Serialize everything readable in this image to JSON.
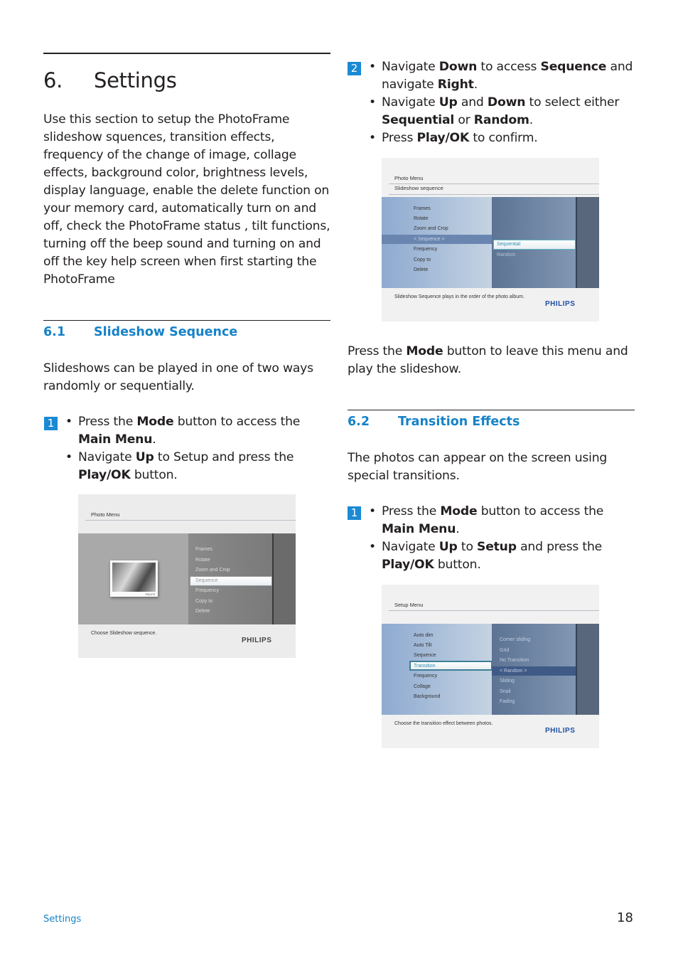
{
  "chapter": {
    "number": "6.",
    "title": "Settings"
  },
  "intro": "Use this section to setup the PhotoFrame slideshow squences, transition effects, frequency of the change of image, collage effects, background color, brightness levels, display language, enable the delete function on your memory card, automatically turn on and off, check the PhotoFrame status , tilt functions, turning off the beep sound and turning on and off the key help screen when first starting the PhotoFrame",
  "section_6_1": {
    "number": "6.1",
    "title": "Slideshow Sequence",
    "description_line1": "Slideshows can be played in one of two ways",
    "description_line2": "randomly or sequentially.",
    "step1": {
      "badge": "1",
      "bullets": [
        {
          "pre": "Press the ",
          "b1": "Mode",
          "mid": " button to access the ",
          "b2": "Main Menu",
          "post": "."
        },
        {
          "pre": "Navigate ",
          "b1": "Up",
          "mid": " to Setup and press the ",
          "b2": "Play/OK",
          "post": " button."
        }
      ]
    },
    "screenshot1": {
      "title": "Photo Menu",
      "menu_items": [
        "Frames",
        "Rotate",
        "Zoom and Crop",
        "Sequence",
        "Frequency",
        "Copy to",
        "Delete"
      ],
      "selected": "Sequence",
      "footer": "Choose Slideshow sequence.",
      "brand": "PHILIPS",
      "thumb_brand": "PHILIPS"
    },
    "step2": {
      "badge": "2",
      "bullets": [
        {
          "pre": "Navigate ",
          "b1": "Down",
          "mid": " to access ",
          "b2": "Sequence",
          "post": " and navigate ",
          "b3": "Right",
          "post2": "."
        },
        {
          "pre": "Navigate ",
          "b1": "Up",
          "mid": " and ",
          "b2": "Down",
          "post": " to select either ",
          "b3": "Sequential",
          "mid2": " or ",
          "b4": "Random",
          "post2": "."
        },
        {
          "pre": "Press ",
          "b1": "Play/OK",
          "post": " to confirm."
        }
      ]
    },
    "screenshot2": {
      "title": "Photo Menu",
      "subtitle": "Slideshow sequence",
      "menu_items": [
        "Frames",
        "Rotate",
        "Zoom and Crop",
        "< Sequence >",
        "Frequency",
        "Copy to",
        "Delete"
      ],
      "options": [
        "Sequential",
        "Random"
      ],
      "selected_option": "Sequential",
      "footer": "Slideshow Sequence plays in the order of the photo album.",
      "brand": "PHILIPS"
    },
    "closing": {
      "pre": "Press the ",
      "b1": "Mode",
      "post": " button to leave this menu and play the slideshow."
    }
  },
  "section_6_2": {
    "number": "6.2",
    "title": "Transition Effects",
    "description_line1": "The photos can appear on the screen using",
    "description_line2": "special transitions.",
    "step1": {
      "badge": "1",
      "bullets": [
        {
          "pre": "Press the ",
          "b1": "Mode",
          "mid": " button to access the ",
          "b2": "Main Menu",
          "post": "."
        },
        {
          "pre": "Navigate ",
          "b1": "Up",
          "mid": " to ",
          "b2": "Setup",
          "post": " and press the ",
          "b3": "Play/OK",
          "post2": " button."
        }
      ]
    },
    "screenshot3": {
      "title": "Setup Menu",
      "menu_items": [
        "Auto dim",
        "Auto Tilt",
        "Sequence",
        "Transition",
        "Frequency",
        "Collage",
        "Background"
      ],
      "selected": "Transition",
      "options": [
        "Corner sliding",
        "Grid",
        "No Transition",
        "< Random >",
        "Sliding",
        "Snail",
        "Fading"
      ],
      "highlighted_option": "< Random >",
      "footer": "Choose the transition effect between photos.",
      "brand": "PHILIPS"
    }
  },
  "footer": {
    "section": "Settings",
    "page": "18"
  },
  "colors": {
    "accent": "#1682c8",
    "badge": "#1a8ad4",
    "philips_blue": "#1f4fa3"
  }
}
